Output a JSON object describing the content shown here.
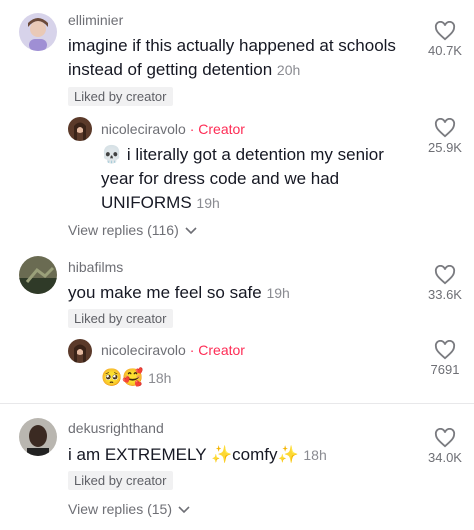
{
  "comments": [
    {
      "username": "elliminier",
      "text": "imagine if this actually happened at schools instead of getting detention",
      "time": "20h",
      "liked_badge": "Liked by creator",
      "likes": "40.7K",
      "reply": {
        "username": "nicoleciravolo",
        "separator": "·",
        "creator_label": "Creator",
        "emoji": "💀",
        "text": "i literally got a detention my senior year for dress code and we had UNIFORMS",
        "time": "19h",
        "likes": "25.9K"
      },
      "view_replies": "View replies (116)"
    },
    {
      "username": "hibafilms",
      "text": "you make me feel so safe",
      "time": "19h",
      "liked_badge": "Liked by creator",
      "likes": "33.6K",
      "reply": {
        "username": "nicoleciravolo",
        "separator": "·",
        "creator_label": "Creator",
        "emoji": "🥺🥰",
        "time": "18h",
        "likes": "7691"
      }
    },
    {
      "username": "dekusrighthand",
      "text_before": "i am EXTREMELY ",
      "sparkle": "✨",
      "text_mid": "comfy",
      "time": "18h",
      "liked_badge": "Liked by creator",
      "likes": "34.0K",
      "view_replies": "View replies (15)"
    }
  ],
  "icons": {
    "like": "heart-outline-icon",
    "chevron": "chevron-down-icon"
  },
  "colors": {
    "creator": "#fe2c55",
    "text": "#161823",
    "muted": "#6e6f75"
  }
}
